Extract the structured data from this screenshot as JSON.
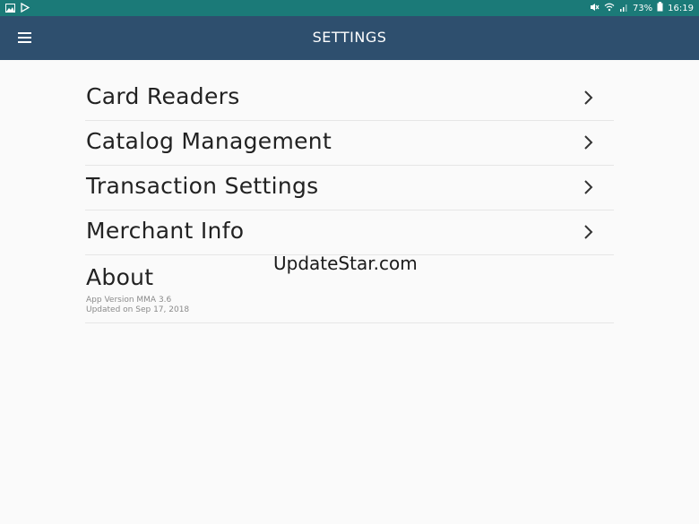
{
  "status_bar": {
    "left_icons": [
      "image-icon",
      "play-store-icon"
    ],
    "battery_percent": "73%",
    "time": "16:19"
  },
  "app_bar": {
    "title": "SETTINGS",
    "menu_icon": "hamburger-menu-icon"
  },
  "settings": {
    "items": [
      {
        "label": "Card Readers"
      },
      {
        "label": "Catalog Management"
      },
      {
        "label": "Transaction Settings"
      },
      {
        "label": "Merchant Info"
      }
    ],
    "about": {
      "label": "About",
      "version": "App Version MMA 3.6",
      "updated": "Updated on Sep 17, 2018"
    }
  },
  "watermark": "UpdateStar.com",
  "colors": {
    "status_bar": "#1b7a78",
    "app_bar": "#2e4f6e",
    "background": "#fafafa"
  }
}
